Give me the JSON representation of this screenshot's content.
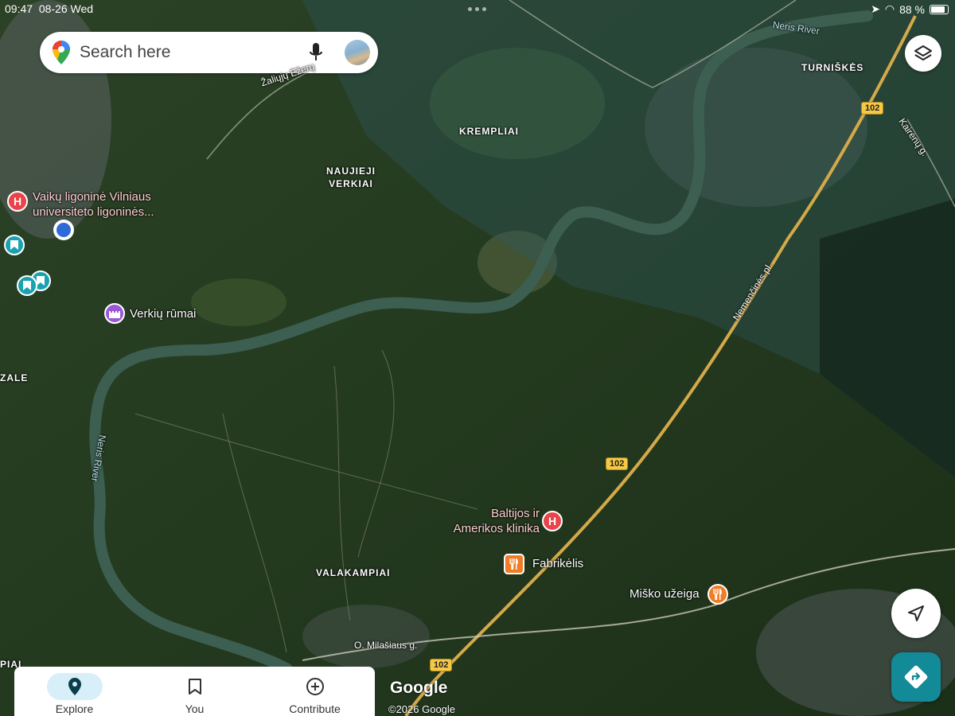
{
  "status_bar": {
    "time": "09:47",
    "date": "08-26 Wed",
    "battery": "88 %"
  },
  "search": {
    "placeholder": "Search here"
  },
  "area_labels": {
    "turniskes": "TURNIŠKĖS",
    "krempliai": "KREMPLIAI",
    "naujieji_verkiai": "NAUJIEJI\nVERKIAI",
    "valakampiai": "VALAKAMPIAI",
    "zale": "ZALE",
    "piai": "PIAI"
  },
  "road_labels": {
    "zaliuju_ezeru": "Žaliųjų Ežerų",
    "nemencines": "Nemenčinės pl.",
    "kairenu": "Kairėnų g.",
    "milasiaus": "O. Milašiaus g.",
    "neris_top": "Neris River",
    "neris_left": "Neris River"
  },
  "route_shields": [
    "102",
    "102",
    "102"
  ],
  "places": {
    "hospital": "Vaikų ligoninė Vilniaus universiteto ligoninės...",
    "verkiu_rumai": "Verkių rūmai",
    "baltijos": "Baltijos ir Amerikos klinika",
    "fabrikelis": "Fabrikėlis",
    "misko_uzeiga": "Miško užeiga"
  },
  "bottom_nav": [
    {
      "label": "Explore",
      "icon": "location-pin-icon",
      "active": true
    },
    {
      "label": "You",
      "icon": "bookmark-icon",
      "active": false
    },
    {
      "label": "Contribute",
      "icon": "add-circle-icon",
      "active": false
    }
  ],
  "attribution": {
    "logo": "Google",
    "copyright": "©2026 Google"
  },
  "colors": {
    "river": "#3c5f52",
    "road": "#d4a94a",
    "forest": "#1e3318",
    "hospital": "#e8444a",
    "food": "#f07c26",
    "landmark": "#9a57d6",
    "saved": "#1aa2b0"
  }
}
